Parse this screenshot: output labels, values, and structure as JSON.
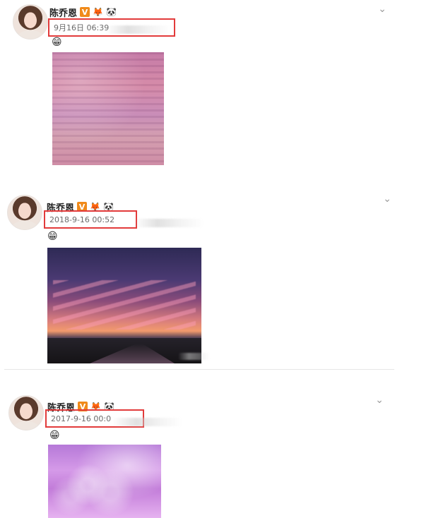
{
  "posts": [
    {
      "user": {
        "name": "陈乔恩",
        "verified": "V"
      },
      "meta": {
        "time": "9月16日 06:39"
      },
      "icons": {
        "badge_1": "🦊",
        "badge_2": "🐼",
        "sticker": "😁"
      }
    },
    {
      "user": {
        "name": "陈乔恩",
        "verified": "V"
      },
      "meta": {
        "time": "2018-9-16 00:52"
      },
      "icons": {
        "badge_1": "🦊",
        "badge_2": "🐼",
        "sticker": "😁"
      }
    },
    {
      "user": {
        "name": "陈乔恩",
        "verified": "V"
      },
      "meta": {
        "time": "2017-9-16 00:0"
      },
      "icons": {
        "badge_1": "🦊",
        "badge_2": "🐼",
        "sticker": "😁"
      }
    }
  ],
  "ui": {
    "chevron_icon": "chevron-down-icon",
    "accent_red": "#e23b3b",
    "verified_orange": "#f08a1a"
  }
}
